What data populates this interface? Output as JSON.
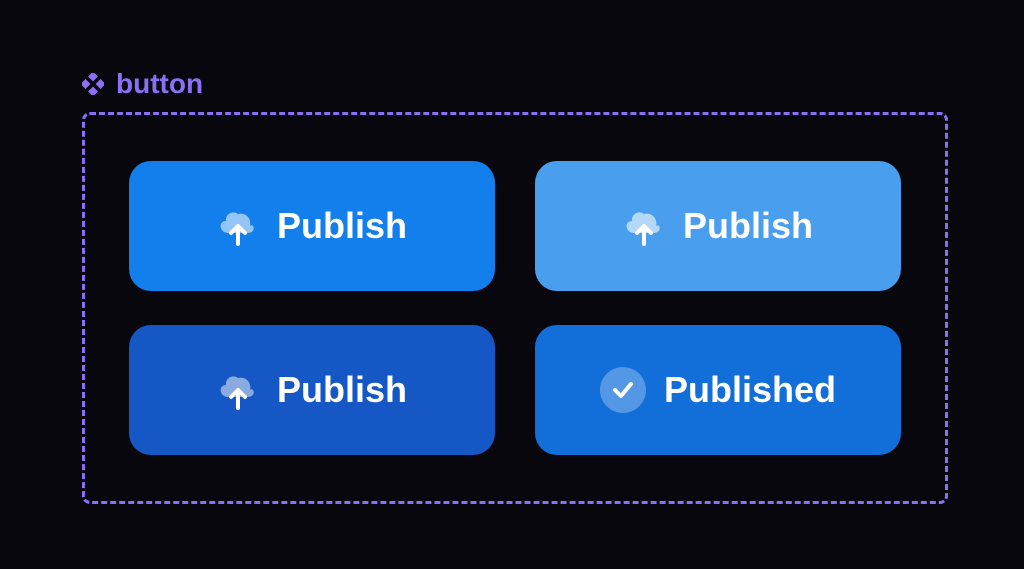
{
  "component": {
    "title": "button"
  },
  "buttons": {
    "default": {
      "label": "Publish"
    },
    "hover": {
      "label": "Publish"
    },
    "active": {
      "label": "Publish"
    },
    "published": {
      "label": "Published"
    }
  }
}
